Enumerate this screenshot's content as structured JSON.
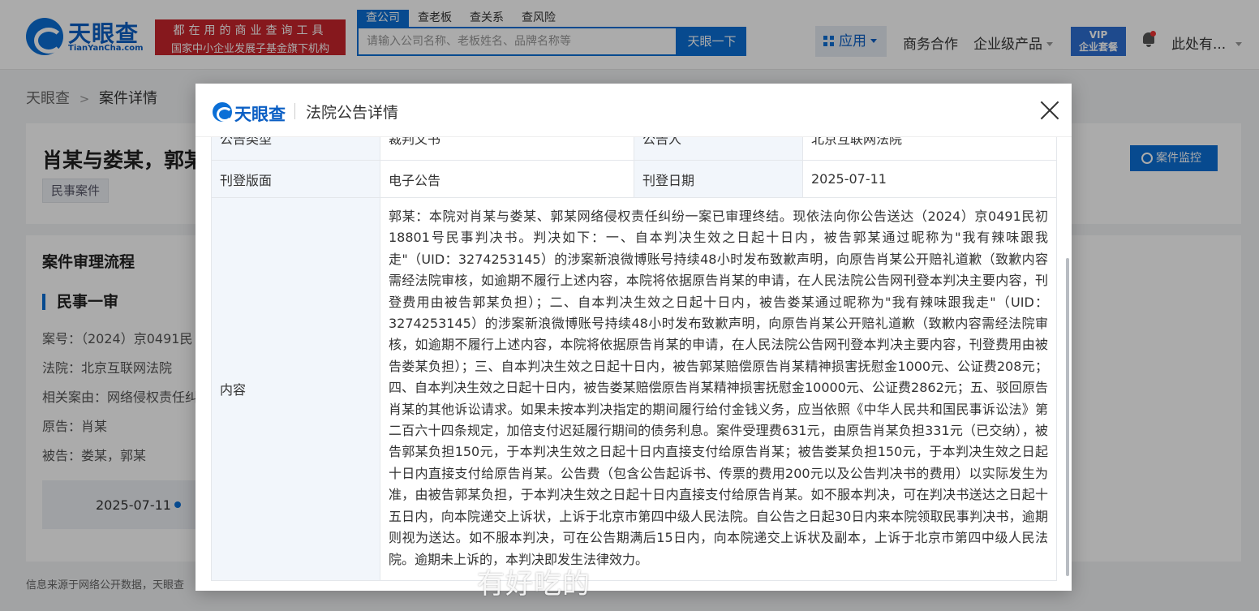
{
  "header": {
    "logo_text": "天眼查",
    "logo_sub": "TianYanCha.com",
    "slogan_line1": "都在用的商业查询工具",
    "slogan_line2": "国家中小企业发展子基金旗下机构",
    "search_tabs": [
      "查公司",
      "查老板",
      "查关系",
      "查风险"
    ],
    "search_placeholder": "请输入公司名称、老板姓名、品牌名称等",
    "search_button": "天眼一下",
    "app_label": "应用",
    "nav_business": "商务合作",
    "nav_enterprise": "企业级产品",
    "vip_line1": "VIP",
    "vip_line2": "企业套餐",
    "user_name": "此处有..."
  },
  "breadcrumb": {
    "root": "天眼查",
    "current": "案件详情"
  },
  "case": {
    "title": "肖某与娄某，郭某",
    "tag": "民事案件",
    "monitor_button": "案件监控"
  },
  "flow": {
    "title": "案件审理流程",
    "stage": "民事一审",
    "case_no": "案号：（2024）京0491民",
    "court": "法院：北京互联网法院",
    "cause": "相关案由：网络侵权责任纠",
    "plaintiff": "原告：肖某",
    "defendant": "被告：娄某，郭某",
    "timeline_date": "2025-07-11"
  },
  "footer_note": "信息来源于网络公开数据，天眼查",
  "modal": {
    "logo_text": "天眼查",
    "title": "法院公告详情",
    "rows": {
      "type_label": "公告类型",
      "type_value": "裁判文书",
      "announcer_label": "公告人",
      "announcer_value": "北京互联网法院",
      "layout_label": "刊登版面",
      "layout_value": "电子公告",
      "date_label": "刊登日期",
      "date_value": "2025-07-11",
      "content_label": "内容",
      "content_value": "郭某：本院对肖某与娄某、郭某网络侵权责任纠纷一案已审理终结。现依法向你公告送达（2024）京0491民初18801号民事判决书。判决如下：一、自本判决生效之日起十日内，被告郭某通过昵称为\"我有辣味跟我走\"（UID：3274253145）的涉案新浪微博账号持续48小时发布致歉声明，向原告肖某公开赔礼道歉（致歉内容需经法院审核，如逾期不履行上述内容，本院将依据原告肖某的申请，在人民法院公告网刊登本判决主要内容，刊登费用由被告郭某负担）；二、自本判决生效之日起十日内，被告娄某通过昵称为\"我有辣味跟我走\"（UID：3274253145）的涉案新浪微博账号持续48小时发布致歉声明，向原告肖某公开赔礼道歉（致歉内容需经法院审核，如逾期不履行上述内容，本院将依据原告肖某的申请，在人民法院公告网刊登本判决主要内容，刊登费用由被告娄某负担）；三、自本判决生效之日起十日内，被告郭某赔偿原告肖某精神损害抚慰金1000元、公证费208元；四、自本判决生效之日起十日内，被告娄某赔偿原告肖某精神损害抚慰金10000元、公证费2862元；五、驳回原告肖某的其他诉讼请求。如果未按本判决指定的期间履行给付金钱义务，应当依照《中华人民共和国民事诉讼法》第二百六十四条规定，加倍支付迟延履行期间的债务利息。案件受理费631元，由原告肖某负担331元（已交纳），被告郭某负担150元，于本判决生效之日起十日内直接支付给原告肖某；被告娄某负担150元，于本判决生效之日起十日内直接支付给原告肖某。公告费（包含公告起诉书、传票的费用200元以及公告判决书的费用）以实际发生为准，由被告郭某负担，于本判决生效之日起十日内直接支付给原告肖某。如不服本判决，可在判决书送达之日起十五日内，向本院递交上诉状，上诉于北京市第四中级人民法院。自公告之日起30日内来本院领取民事判决书，逾期则视为送达。如不服本判决，可在公告期满后15日内，向本院递交上诉状及副本，上诉于北京市第四中级人民法院。逾期未上诉的，本判决即发生法律效力。"
    }
  },
  "watermark": "有好吃的"
}
